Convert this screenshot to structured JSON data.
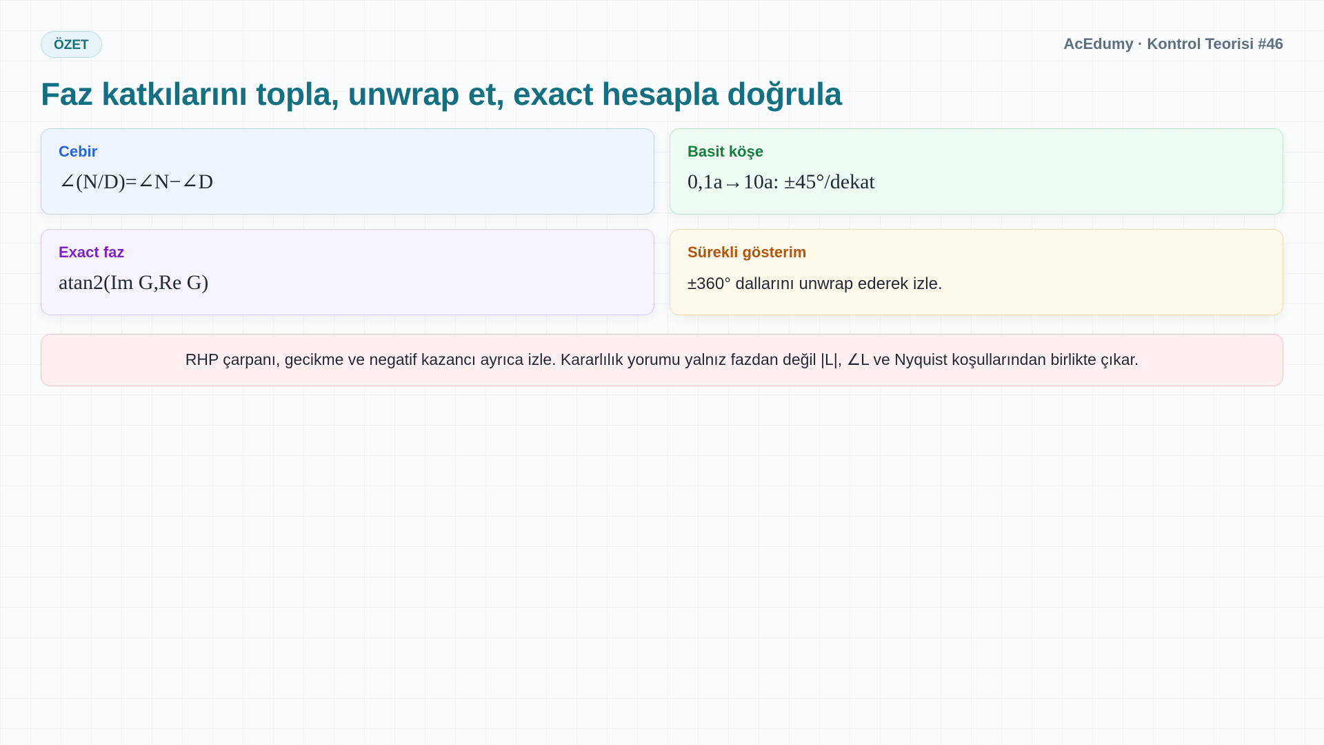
{
  "header": {
    "badge": "ÖZET",
    "brand": "AcEdumy · Kontrol Teorisi #46",
    "title": "Faz katkılarını topla, unwrap et, exact hesapla doğrula"
  },
  "cards": [
    {
      "label": "Cebir",
      "value": "∠(N/D)=∠N−∠D"
    },
    {
      "label": "Basit köşe",
      "value": "0,1a→10a: ±45°/dekat"
    },
    {
      "label": "Exact faz",
      "value": "atan2(Im G,Re G)"
    },
    {
      "label": "Sürekli gösterim",
      "value": "±360° dallarını unwrap ederek izle."
    }
  ],
  "note": "RHP çarpanı, gecikme ve negatif kazancı ayrıca izle. Kararlılık yorumu yalnız fazdan değil |L|, ∠L ve Nyquist koşullarından birlikte çıkar.",
  "colors": {
    "accent": "#137083",
    "blue": "#2563eb",
    "green": "#15803d",
    "purple": "#7e22ce",
    "amber": "#b45309"
  }
}
